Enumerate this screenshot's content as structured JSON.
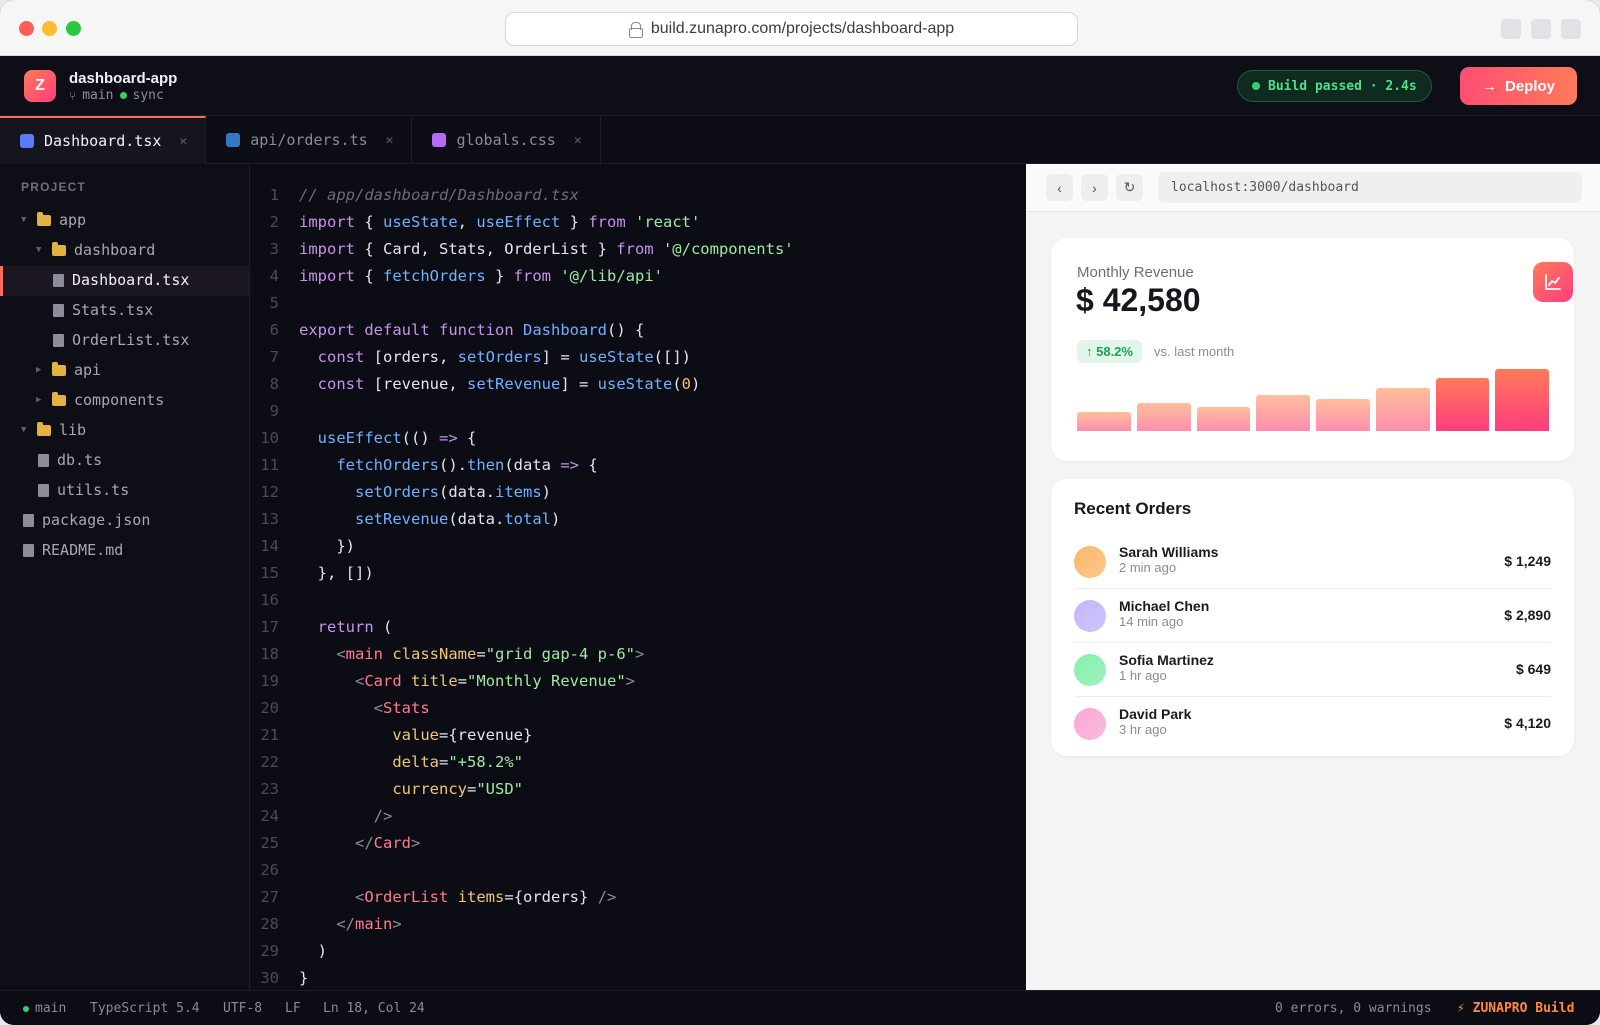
{
  "browser": {
    "url": "build.zunapro.com/projects/dashboard-app"
  },
  "app": {
    "logo_letter": "Z",
    "project_name": "dashboard-app",
    "branch": "main",
    "sync_label": "sync",
    "build_status": "Build passed · 2.4s",
    "deploy_label": "Deploy"
  },
  "tabs": [
    {
      "label": "Dashboard.tsx",
      "color": "#5b7cfa",
      "active": true
    },
    {
      "label": "api/orders.ts",
      "color": "#3178c6",
      "active": false
    },
    {
      "label": "globals.css",
      "color": "#b46cf2",
      "active": false
    }
  ],
  "sidebar": {
    "title": "PROJECT",
    "items": [
      {
        "label": "app",
        "kind": "folder",
        "depth": 0,
        "open": true
      },
      {
        "label": "dashboard",
        "kind": "folder",
        "depth": 1,
        "open": true
      },
      {
        "label": "Dashboard.tsx",
        "kind": "file",
        "depth": 2,
        "selected": true
      },
      {
        "label": "Stats.tsx",
        "kind": "file",
        "depth": 2
      },
      {
        "label": "OrderList.tsx",
        "kind": "file",
        "depth": 2
      },
      {
        "label": "api",
        "kind": "folder",
        "depth": 1,
        "open": false
      },
      {
        "label": "components",
        "kind": "folder",
        "depth": 1,
        "open": false
      },
      {
        "label": "lib",
        "kind": "folder",
        "depth": 0,
        "open": true
      },
      {
        "label": "db.ts",
        "kind": "file",
        "depth": 1
      },
      {
        "label": "utils.ts",
        "kind": "file",
        "depth": 1
      },
      {
        "label": "package.json",
        "kind": "file",
        "depth": 0
      },
      {
        "label": "README.md",
        "kind": "file",
        "depth": 0
      }
    ]
  },
  "editor": {
    "lines": [
      "// app/dashboard/Dashboard.tsx",
      "import { useState, useEffect } from 'react'",
      "import { Card, Stats, OrderList } from '@/components'",
      "import { fetchOrders } from '@/lib/api'",
      "",
      "export default function Dashboard() {",
      "  const [orders, setOrders] = useState([])",
      "  const [revenue, setRevenue] = useState(0)",
      "",
      "  useEffect(() => {",
      "    fetchOrders().then(data => {",
      "      setOrders(data.items)",
      "      setRevenue(data.total)",
      "    })",
      "  }, [])",
      "",
      "  return (",
      "    <main className=\"grid gap-4 p-6\">",
      "      <Card title=\"Monthly Revenue\">",
      "        <Stats",
      "          value={revenue}",
      "          delta=\"+58.2%\"",
      "          currency=\"USD\"",
      "        />",
      "      </Card>",
      "",
      "      <OrderList items={orders} />",
      "    </main>",
      "  )",
      "}"
    ]
  },
  "preview": {
    "url": "localhost:3000/dashboard",
    "revenue": {
      "label": "Monthly Revenue",
      "value": "$ 42,580",
      "delta": "↑ 58.2%",
      "delta_note": "vs. last month",
      "bar_levels": [
        0.3,
        0.45,
        0.38,
        0.58,
        0.52,
        0.7,
        0.85,
        1.0
      ]
    },
    "orders": {
      "title": "Recent Orders",
      "items": [
        {
          "name": "Sarah Williams",
          "time": "2 min ago",
          "amount": "$ 1,249",
          "avatar_color": "#fbb86b"
        },
        {
          "name": "Michael Chen",
          "time": "14 min ago",
          "amount": "$ 2,890",
          "avatar_color": "#c4b5fd"
        },
        {
          "name": "Sofia Martinez",
          "time": "1 hr ago",
          "amount": "$ 649",
          "avatar_color": "#86efac"
        },
        {
          "name": "David Park",
          "time": "3 hr ago",
          "amount": "$ 4,120",
          "avatar_color": "#f9a8d4"
        }
      ]
    }
  },
  "statusbar": {
    "branch": "main",
    "language": "TypeScript 5.4",
    "encoding": "UTF-8",
    "eol": "LF",
    "cursor": "Ln 18, Col 24",
    "problems": "0 errors, 0 warnings",
    "brand": "⚡ ZUNAPRO Build"
  }
}
